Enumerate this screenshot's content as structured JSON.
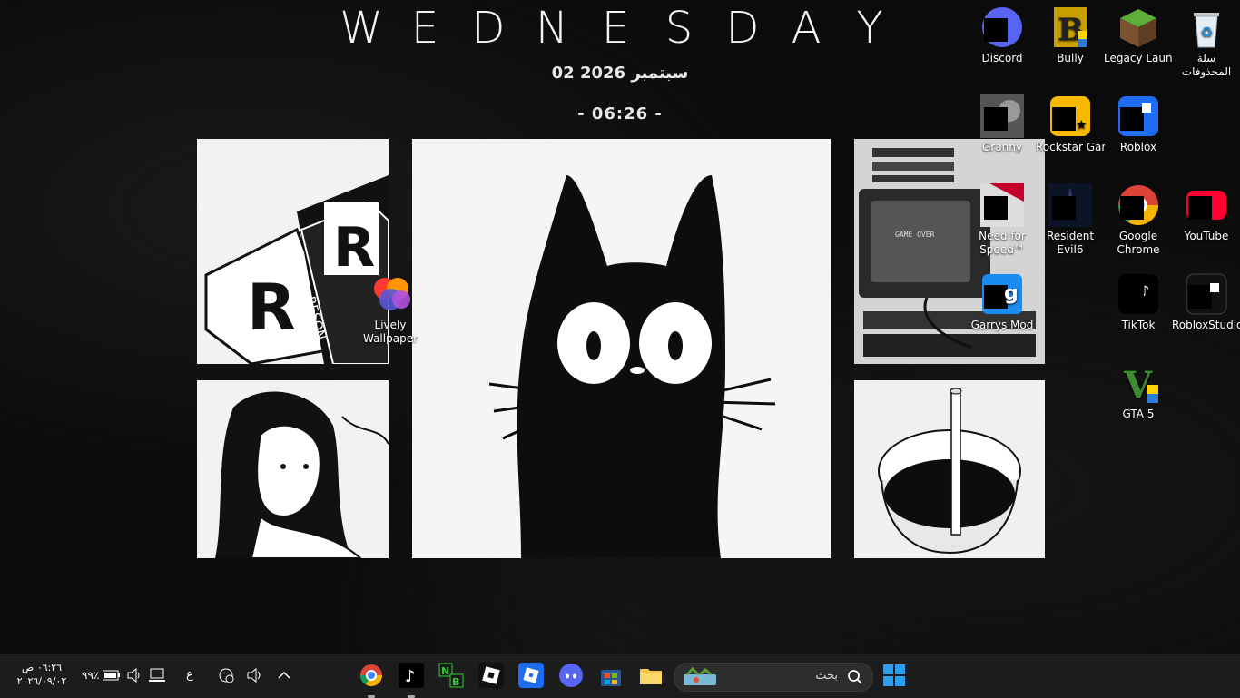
{
  "wallpaper": {
    "title_letters": [
      "W",
      "E",
      "D",
      "N",
      "E",
      "S",
      "D",
      "A",
      "Y"
    ],
    "date": "02 سبتمبر 2026",
    "time": "- 06:26 -",
    "panel1_text": "RESON",
    "panel4_text": "GAME OVER"
  },
  "desktop_icons": [
    {
      "name": "discord",
      "label": "Discord"
    },
    {
      "name": "bully",
      "label": "Bully"
    },
    {
      "name": "legacy-launcher",
      "label": "Legacy Launch..."
    },
    {
      "name": "recycle-bin",
      "label": "سلة المحذوفات"
    },
    {
      "name": "granny",
      "label": "Granny"
    },
    {
      "name": "rockstar",
      "label": "Rockstar Games ..."
    },
    {
      "name": "roblox",
      "label": "Roblox"
    },
    {
      "name": "nfs",
      "label": "Need for Speed™ Mo..."
    },
    {
      "name": "resident-evil",
      "label": "Resident Evil6"
    },
    {
      "name": "chrome",
      "label": "Google Chrome"
    },
    {
      "name": "youtube",
      "label": "YouTube"
    },
    {
      "name": "garrys-mod",
      "label": "Garrys Mod"
    },
    {
      "name": "tiktok",
      "label": "TikTok"
    },
    {
      "name": "roblox-studio",
      "label": "RobloxStudio"
    },
    {
      "name": "gta5",
      "label": "GTA 5"
    },
    {
      "name": "lively",
      "label": "Lively Wallpaper"
    }
  ],
  "taskbar": {
    "search_placeholder": "بحث",
    "clock_time": "٠٦:٢٦ ص",
    "clock_date": "٢٠٢٦/٠٩/٠٢",
    "battery": "٩٩٪",
    "lang": "ع",
    "pinned": [
      "chrome",
      "tiktok",
      "nb",
      "roblox-studio",
      "roblox",
      "discord",
      "store",
      "explorer"
    ]
  },
  "colors": {
    "discord": "#5865f2",
    "roblox": "#1e6cf0",
    "youtube": "#ff0033",
    "taskbar": "#1c1c1c",
    "windows_blue": "#2a9df4"
  }
}
